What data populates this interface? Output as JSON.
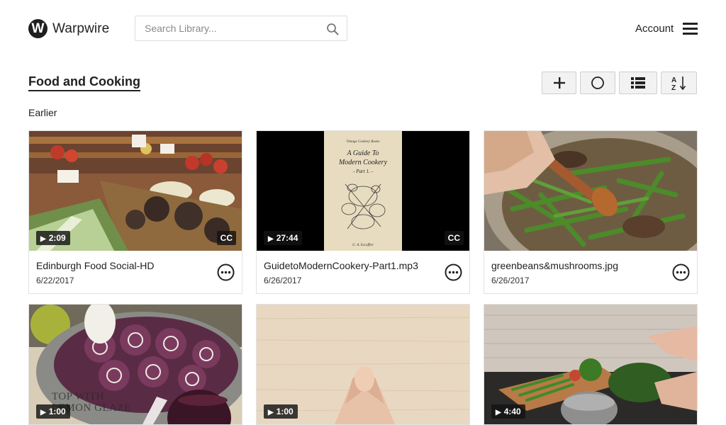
{
  "header": {
    "logo_letter": "W",
    "brand": "Warpwire",
    "search_placeholder": "Search Library...",
    "account_label": "Account"
  },
  "page": {
    "title": "Food and Cooking",
    "section": "Earlier"
  },
  "toolbar": {
    "add_icon": "plus-icon",
    "record_icon": "circle-icon",
    "view_icon": "list-view-icon",
    "sort_icon": "sort-az-icon"
  },
  "colors": {
    "text": "#222222",
    "border": "#e2e2e2",
    "button_bg": "#f2f2f2",
    "badge_bg": "#141414"
  },
  "media": [
    {
      "title": "Edinburgh Food Social-HD",
      "date": "6/22/2017",
      "duration": "2:09",
      "cc": "CC",
      "thumbnail": "market-vegetables"
    },
    {
      "title": "GuidetoModernCookery-Part1.mp3",
      "date": "6/26/2017",
      "duration": "27:44",
      "cc": "CC",
      "thumbnail": "book-cover",
      "cover": {
        "series": "Vintage Cookery Books",
        "line1": "A Guide To",
        "line2": "Modern Cookery",
        "line3": "- Part 1. -",
        "author": "G. A. Escoffier"
      }
    },
    {
      "title": "greenbeans&mushrooms.jpg",
      "date": "6/26/2017",
      "duration": "",
      "cc": "",
      "thumbnail": "green-beans-pan"
    },
    {
      "title": "",
      "date": "",
      "duration": "1:00",
      "cc": "",
      "thumbnail": "berry-rolls",
      "overlay_line1": "TOP WITH",
      "overlay_line2": "LEMON GLAZE"
    },
    {
      "title": "",
      "date": "",
      "duration": "1:00",
      "cc": "",
      "thumbnail": "hands-on-wood"
    },
    {
      "title": "",
      "date": "",
      "duration": "4:40",
      "cc": "",
      "thumbnail": "kitchen-counter"
    }
  ]
}
